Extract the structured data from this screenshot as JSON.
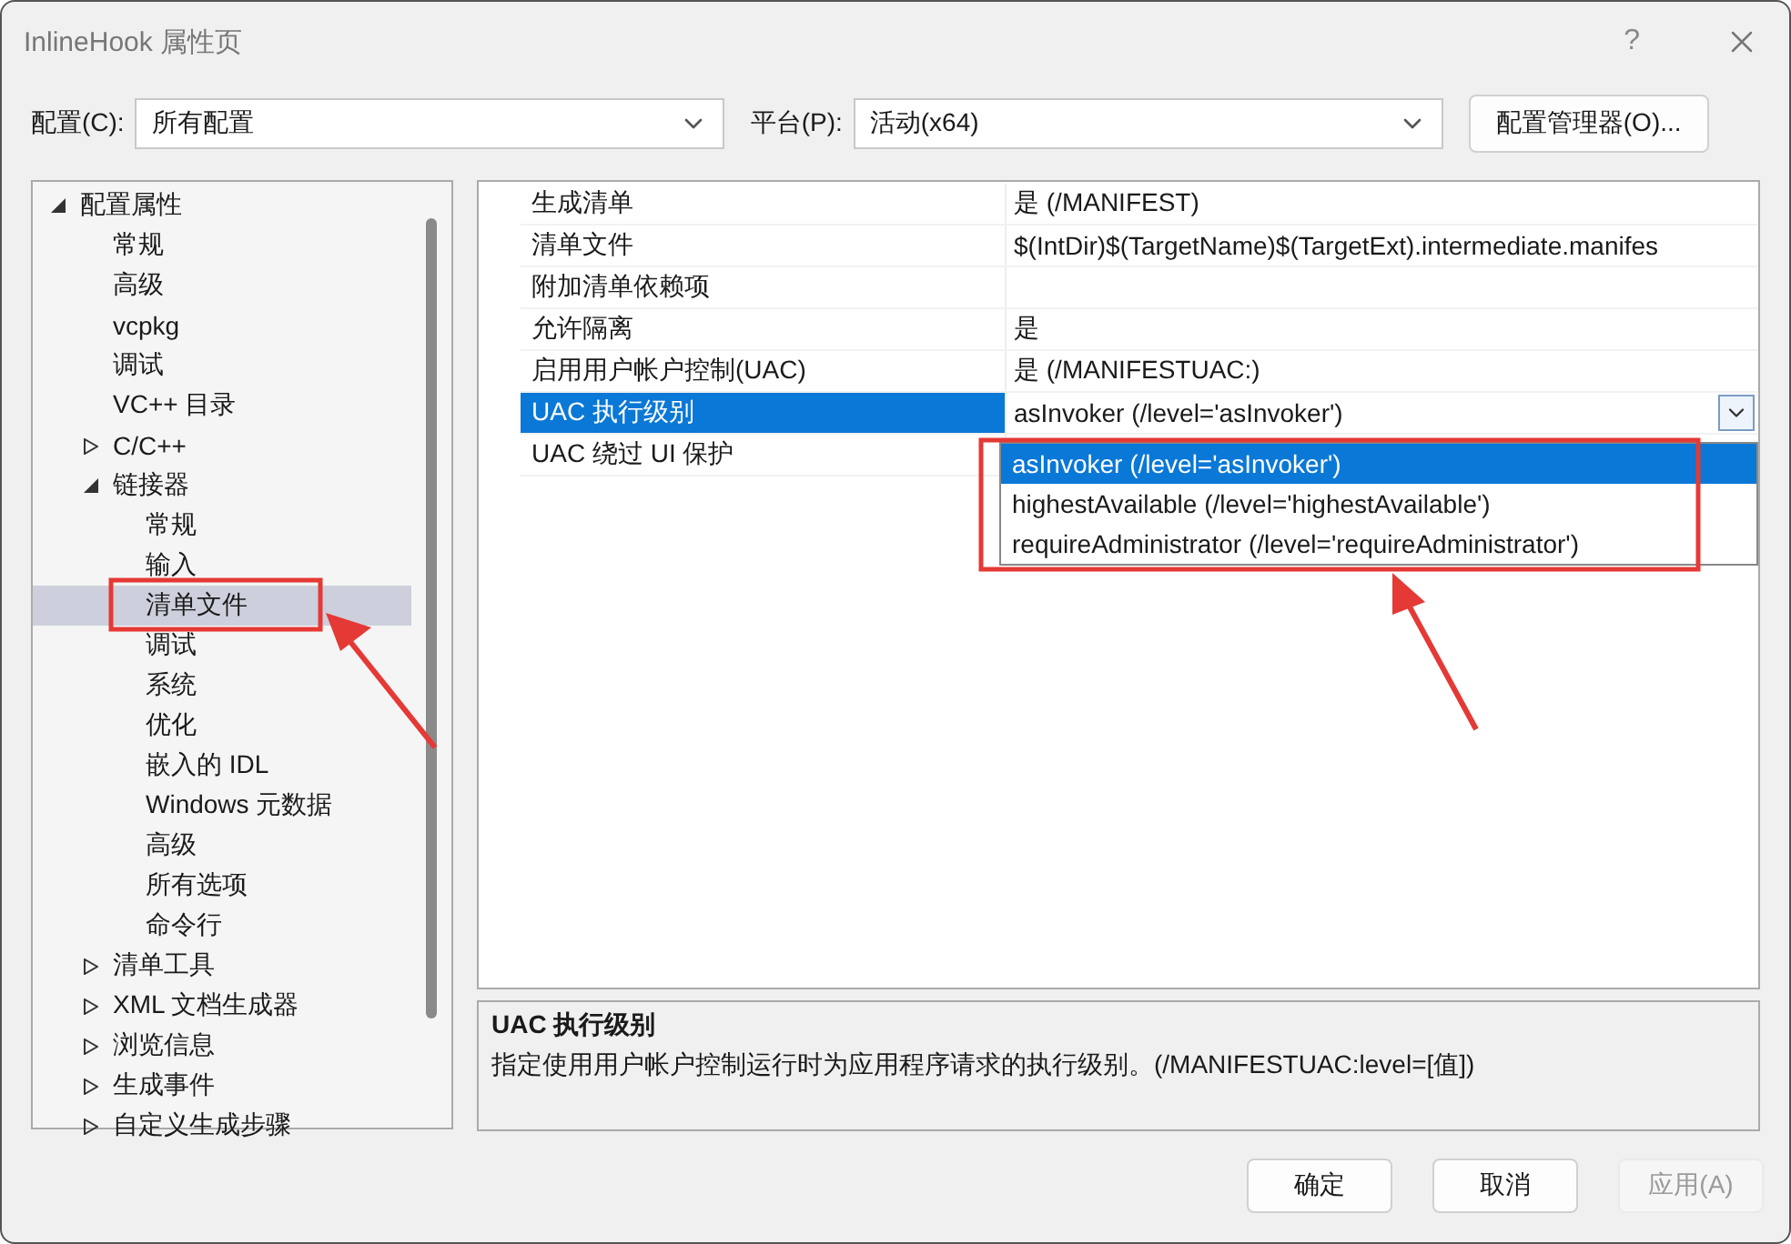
{
  "window": {
    "title": "InlineHook 属性页",
    "help": "?"
  },
  "configuration": {
    "label": "配置(C):",
    "value": "所有配置"
  },
  "platform": {
    "label": "平台(P):",
    "value": "活动(x64)"
  },
  "manager_button": "配置管理器(O)...",
  "tree": [
    {
      "label": "配置属性",
      "expanded": true,
      "selected": false,
      "children": [
        {
          "label": "常规",
          "selected": false
        },
        {
          "label": "高级",
          "selected": false
        },
        {
          "label": "vcpkg",
          "selected": false
        },
        {
          "label": "调试",
          "selected": false
        },
        {
          "label": "VC++ 目录",
          "selected": false
        },
        {
          "label": "C/C++",
          "expanded": false,
          "selected": false
        },
        {
          "label": "链接器",
          "expanded": true,
          "selected": false,
          "children": [
            {
              "label": "常规",
              "selected": false
            },
            {
              "label": "输入",
              "selected": false
            },
            {
              "label": "清单文件",
              "selected": true
            },
            {
              "label": "调试",
              "selected": false
            },
            {
              "label": "系统",
              "selected": false
            },
            {
              "label": "优化",
              "selected": false
            },
            {
              "label": "嵌入的 IDL",
              "selected": false
            },
            {
              "label": "Windows 元数据",
              "selected": false
            },
            {
              "label": "高级",
              "selected": false
            },
            {
              "label": "所有选项",
              "selected": false
            },
            {
              "label": "命令行",
              "selected": false
            }
          ]
        },
        {
          "label": "清单工具",
          "expanded": false,
          "selected": false
        },
        {
          "label": "XML 文档生成器",
          "expanded": false,
          "selected": false
        },
        {
          "label": "浏览信息",
          "expanded": false,
          "selected": false
        },
        {
          "label": "生成事件",
          "expanded": false,
          "selected": false
        },
        {
          "label": "自定义生成步骤",
          "expanded": false,
          "selected": false
        }
      ]
    }
  ],
  "property_grid": {
    "rows": [
      {
        "name": "生成清单",
        "value": "是 (/MANIFEST)",
        "selected": false
      },
      {
        "name": "清单文件",
        "value": "$(IntDir)$(TargetName)$(TargetExt).intermediate.manifes",
        "selected": false
      },
      {
        "name": "附加清单依赖项",
        "value": "",
        "selected": false
      },
      {
        "name": "允许隔离",
        "value": "是",
        "selected": false
      },
      {
        "name": "启用用户帐户控制(UAC)",
        "value": "是 (/MANIFESTUAC:)",
        "selected": false
      },
      {
        "name": "UAC 执行级别",
        "value": "asInvoker (/level='asInvoker')",
        "selected": true
      },
      {
        "name": "UAC 绕过 UI 保护",
        "value": "",
        "selected": false
      }
    ],
    "dropdown_options": [
      {
        "label": "asInvoker (/level='asInvoker')",
        "selected": true
      },
      {
        "label": "highestAvailable (/level='highestAvailable')",
        "selected": false
      },
      {
        "label": "requireAdministrator (/level='requireAdministrator')",
        "selected": false
      }
    ]
  },
  "description": {
    "title": "UAC 执行级别",
    "text": "指定使用用户帐户控制运行时为应用程序请求的执行级别。(/MANIFESTUAC:level=[值])"
  },
  "buttons": [
    {
      "label": "确定",
      "disabled": false
    },
    {
      "label": "取消",
      "disabled": false
    },
    {
      "label": "应用(A)",
      "disabled": true
    }
  ]
}
